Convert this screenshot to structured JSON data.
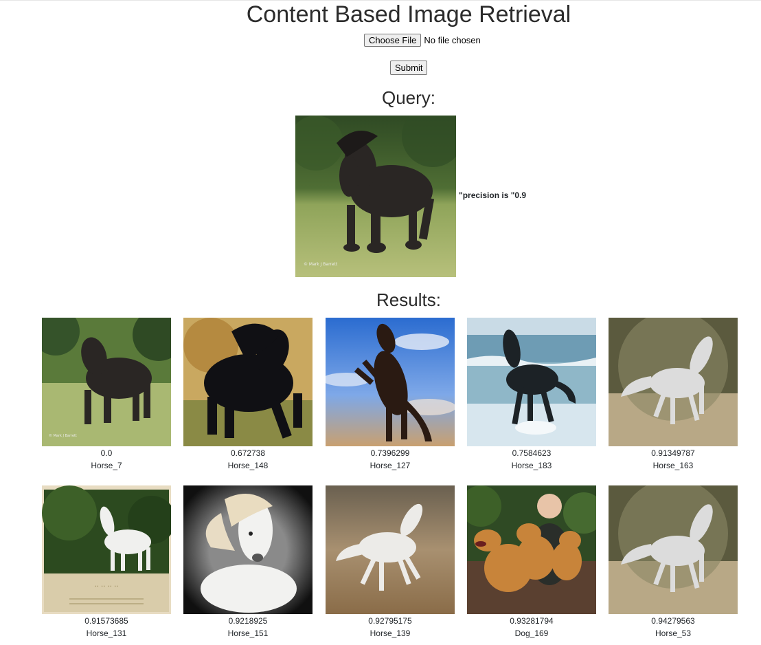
{
  "header": {
    "title": "Content Based Image Retrieval"
  },
  "form": {
    "choose_file_label": "Choose File",
    "file_status": "No file chosen",
    "submit_label": "Submit"
  },
  "query": {
    "heading": "Query:",
    "precision_text": "\"precision is \"0.9"
  },
  "results": {
    "heading": "Results:",
    "items": [
      {
        "score": "0.0",
        "label": "Horse_7"
      },
      {
        "score": "0.672738",
        "label": "Horse_148"
      },
      {
        "score": "0.7396299",
        "label": "Horse_127"
      },
      {
        "score": "0.7584623",
        "label": "Horse_183"
      },
      {
        "score": "0.91349787",
        "label": "Horse_163"
      },
      {
        "score": "0.91573685",
        "label": "Horse_131"
      },
      {
        "score": "0.9218925",
        "label": "Horse_151"
      },
      {
        "score": "0.92795175",
        "label": "Horse_139"
      },
      {
        "score": "0.93281794",
        "label": "Dog_169"
      },
      {
        "score": "0.94279563",
        "label": "Horse_53"
      }
    ]
  }
}
